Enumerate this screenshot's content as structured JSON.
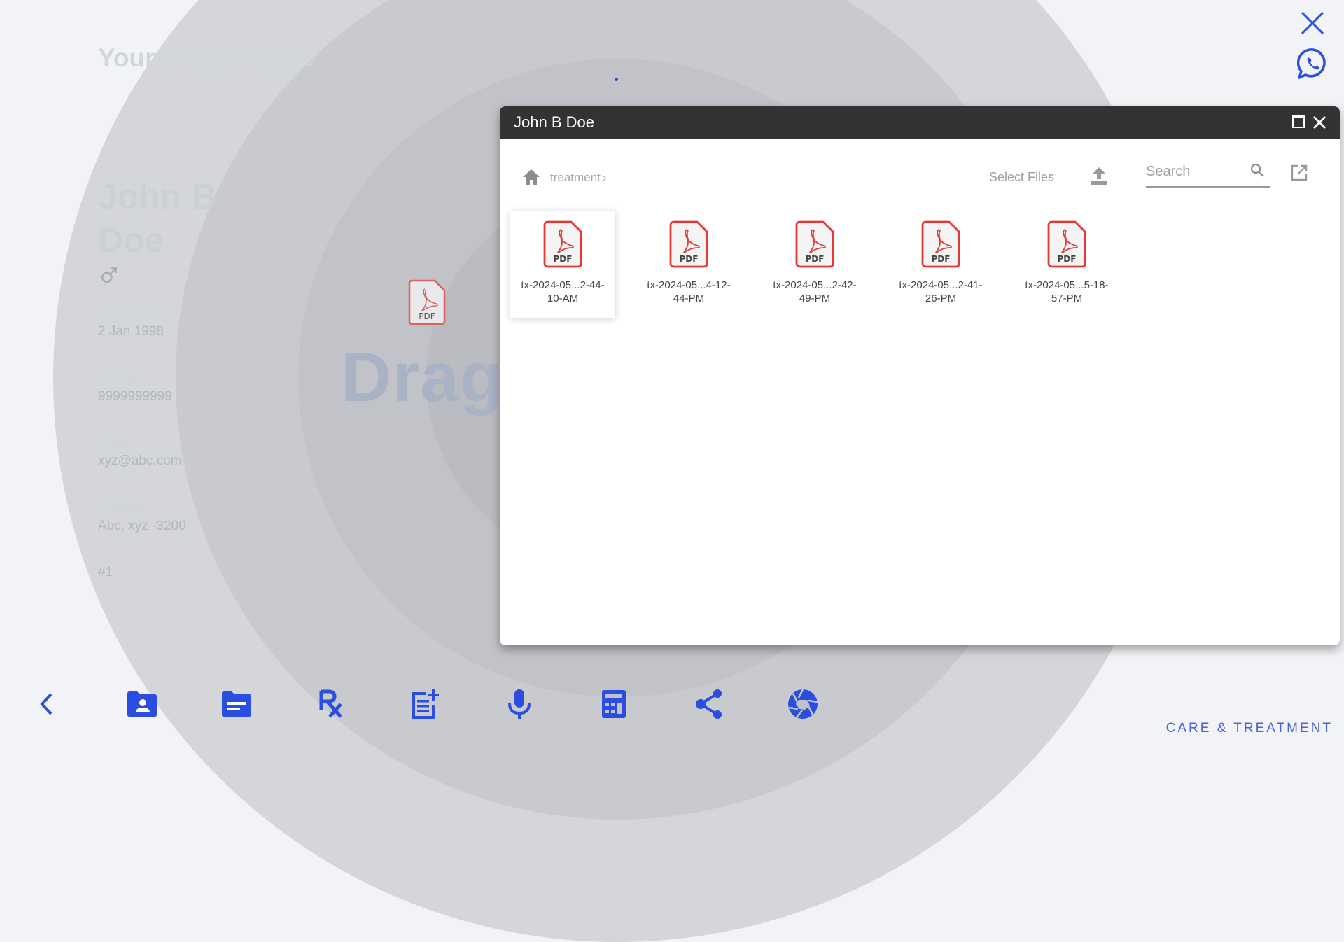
{
  "colors": {
    "accent": "#2a4fe0",
    "pdf_red": "#e53935",
    "dialog_header": "#333333",
    "care_label": "#4a63d9"
  },
  "background": {
    "brand_name": "Your Brand Name",
    "patient": {
      "name_line1": "John B",
      "name_line2": "Doe",
      "gender_icon": "male-icon",
      "fields": [
        {
          "label": "Date of birth",
          "value": "2 Jan 1998"
        },
        {
          "label": "Mobile",
          "value": "9999999999"
        },
        {
          "label": "Email",
          "value": "xyz@abc.com"
        },
        {
          "label": "Address",
          "value": "Abc, xyz -3200"
        }
      ],
      "number": "#1"
    },
    "drag_hint": "Drag",
    "dragged_file_label": "PDF"
  },
  "top_actions": {
    "close_icon": "close-icon",
    "whatsapp_icon": "whatsapp-icon"
  },
  "dialog": {
    "title": "John B Doe",
    "maximize_icon": "maximize-icon",
    "close_icon": "close-icon",
    "breadcrumb": {
      "home_icon": "home-icon",
      "items": [
        "treatment"
      ],
      "separator": "›"
    },
    "select_files_label": "Select Files",
    "upload_icon": "upload-icon",
    "search": {
      "placeholder": "Search",
      "value": ""
    },
    "open_external_icon": "open-in-new-icon",
    "files": [
      {
        "line1": "tx-2024-05...2-44-",
        "line2": "10-AM",
        "type": "PDF",
        "selected": true
      },
      {
        "line1": "tx-2024-05...4-12-",
        "line2": "44-PM",
        "type": "PDF",
        "selected": false
      },
      {
        "line1": "tx-2024-05...2-42-",
        "line2": "49-PM",
        "type": "PDF",
        "selected": false
      },
      {
        "line1": "tx-2024-05...2-41-",
        "line2": "26-PM",
        "type": "PDF",
        "selected": false
      },
      {
        "line1": "tx-2024-05...5-18-",
        "line2": "57-PM",
        "type": "PDF",
        "selected": false
      }
    ]
  },
  "bottom_bar": {
    "items": [
      {
        "name": "back",
        "icon": "chevron-left-icon"
      },
      {
        "name": "patient-folder",
        "icon": "folder-shared-icon"
      },
      {
        "name": "records-folder",
        "icon": "folder-list-icon"
      },
      {
        "name": "prescription",
        "icon": "rx-icon"
      },
      {
        "name": "add-note",
        "icon": "post-add-icon"
      },
      {
        "name": "voice",
        "icon": "microphone-icon"
      },
      {
        "name": "calculator",
        "icon": "calculator-icon"
      },
      {
        "name": "share",
        "icon": "share-icon"
      },
      {
        "name": "camera",
        "icon": "camera-aperture-icon"
      }
    ]
  },
  "section_label": "CARE & TREATMENT"
}
